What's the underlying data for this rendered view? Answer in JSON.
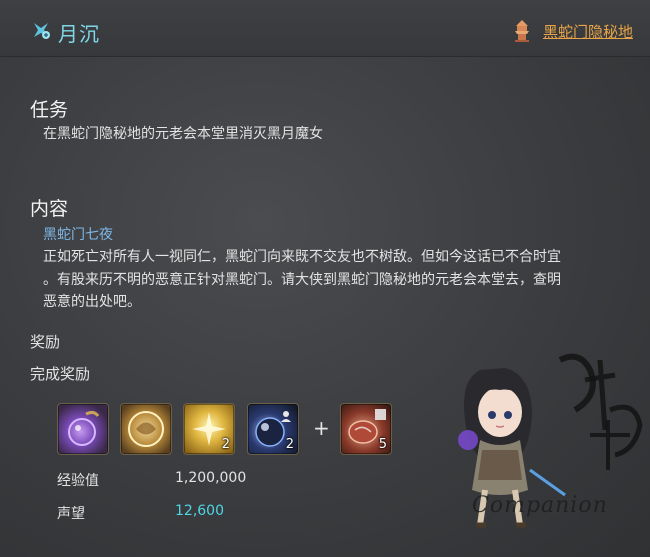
{
  "header": {
    "title": "月沉",
    "location_link": "黑蛇门隐秘地"
  },
  "mission": {
    "heading": "任务",
    "objective": "在黑蛇门隐秘地的元老会本堂里消灭黑月魔女"
  },
  "content": {
    "heading": "内容",
    "subtitle": "黑蛇门七夜",
    "lines": [
      "正如死亡对所有人一视同仁，黑蛇门向来既不交友也不树敌。但如今这话已不合时宜",
      "。有股来历不明的恶意正针对黑蛇门。请大侠到黑蛇门隐秘地的元老会本堂去，查明",
      "恶意的出处吧。"
    ]
  },
  "reward": {
    "heading": "奖励",
    "completion_label": "完成奖励",
    "items": [
      {
        "icon": "purple-orb-pouch-icon",
        "count": "",
        "accent": "#8a5fd0"
      },
      {
        "icon": "golden-orb-icon",
        "count": "",
        "accent": "#c9a35a"
      },
      {
        "icon": "gold-sparkle-icon",
        "count": "2",
        "accent": "#d8b24a"
      },
      {
        "icon": "dark-sphere-icon",
        "count": "2",
        "accent": "#4a6aa8"
      },
      {
        "icon": "red-gem-icon",
        "count": "5",
        "accent": "#a84a3a"
      }
    ],
    "plus": "+",
    "exp_label": "经验值",
    "exp_value": "1,200,000",
    "rep_label": "声望",
    "rep_value": "12,600"
  },
  "watermark": {
    "text": "Companion",
    "calligraphy": "攻略组"
  },
  "colors": {
    "title": "#7fd7e8",
    "link": "#e7a448",
    "subtitle": "#7fb8e8",
    "reputation": "#4fd6e6"
  }
}
